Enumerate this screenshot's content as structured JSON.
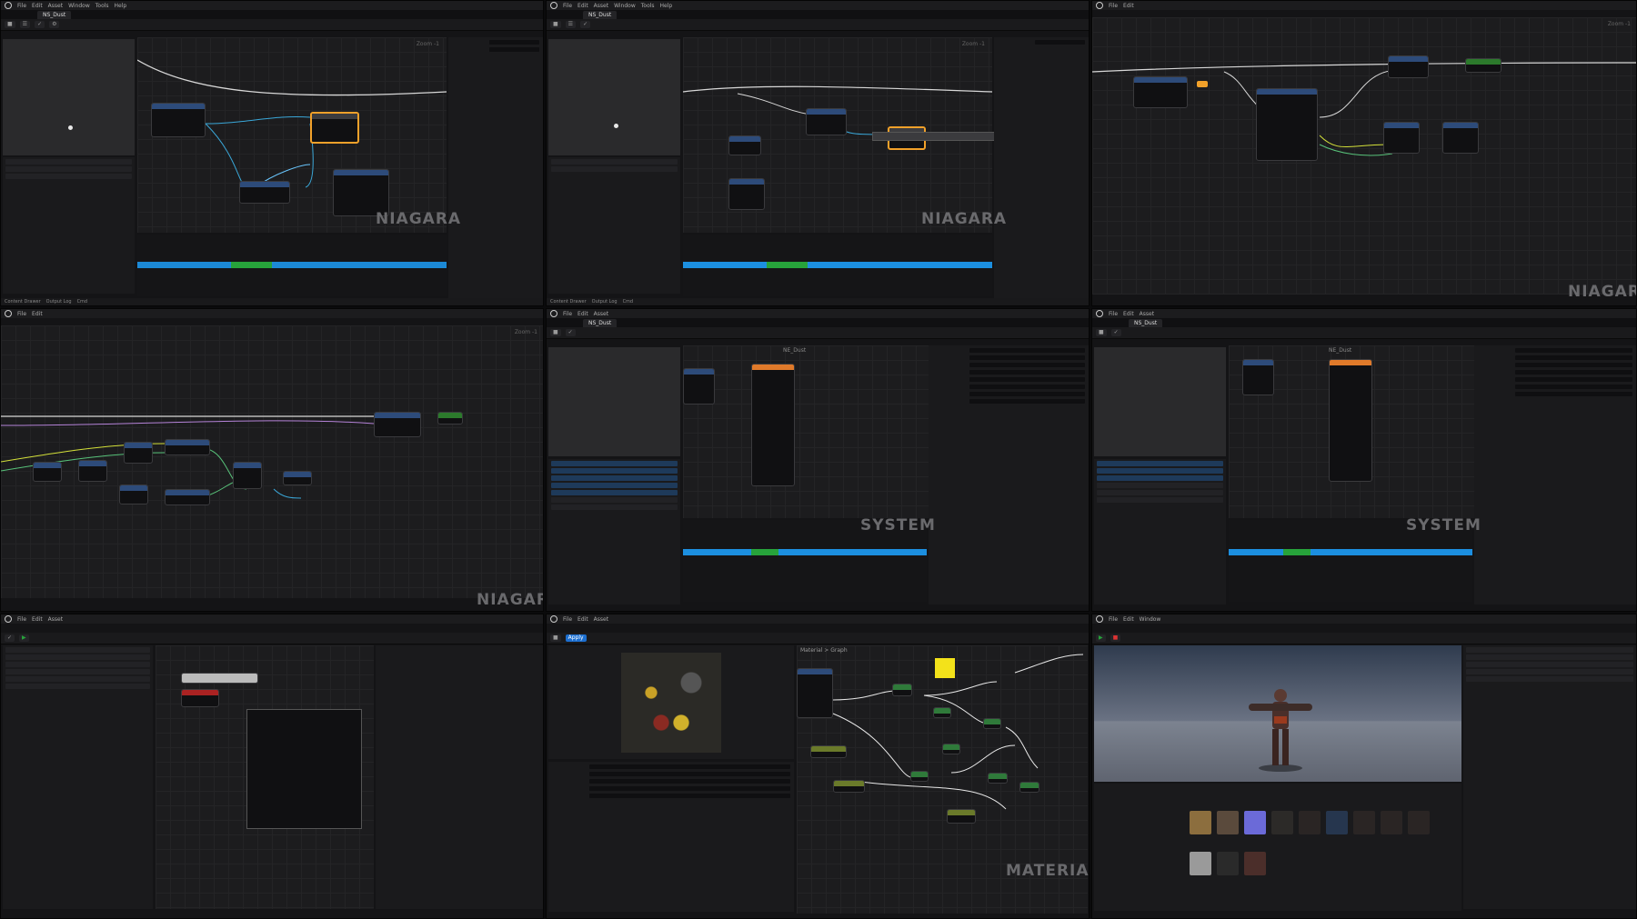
{
  "panels": [
    {
      "watermark": "NIAGARA",
      "tab": "NS_Dust"
    },
    {
      "watermark": "NIAGARA",
      "tab": "NS_Dust"
    },
    {
      "watermark": "NIAGARA",
      "tab": ""
    },
    {
      "watermark": "NIAGARA",
      "tab": ""
    },
    {
      "watermark": "SYSTEM",
      "tab": "NS_Dust"
    },
    {
      "watermark": "SYSTEM",
      "tab": "NS_Dust"
    },
    {
      "watermark": "",
      "tab": ""
    },
    {
      "watermark": "MATERIAL",
      "tab": ""
    },
    {
      "watermark": "",
      "tab": ""
    }
  ],
  "labels": {
    "zoom": "Zoom -1",
    "graph_title": "NE_Dust",
    "material_breadcrumb": "Material > Graph"
  },
  "colors": {
    "accent_blue": "#1c8fe0",
    "accent_green": "#27a33b",
    "selection_orange": "#f2a12a",
    "yellow_param": "#f3e21a"
  }
}
